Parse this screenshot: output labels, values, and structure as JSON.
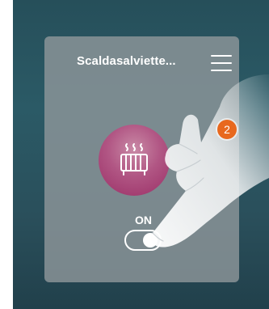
{
  "card": {
    "title": "Scaldasalviette...",
    "state_label": "ON",
    "toggle_on": true
  },
  "annotation": {
    "step_number": "2"
  },
  "icons": {
    "menu": "hamburger-menu-icon",
    "device": "towel-warmer-icon"
  },
  "colors": {
    "background": "#2a5865",
    "card": "#8e969a",
    "device_circle": "#b15684",
    "badge": "#e8681e"
  }
}
